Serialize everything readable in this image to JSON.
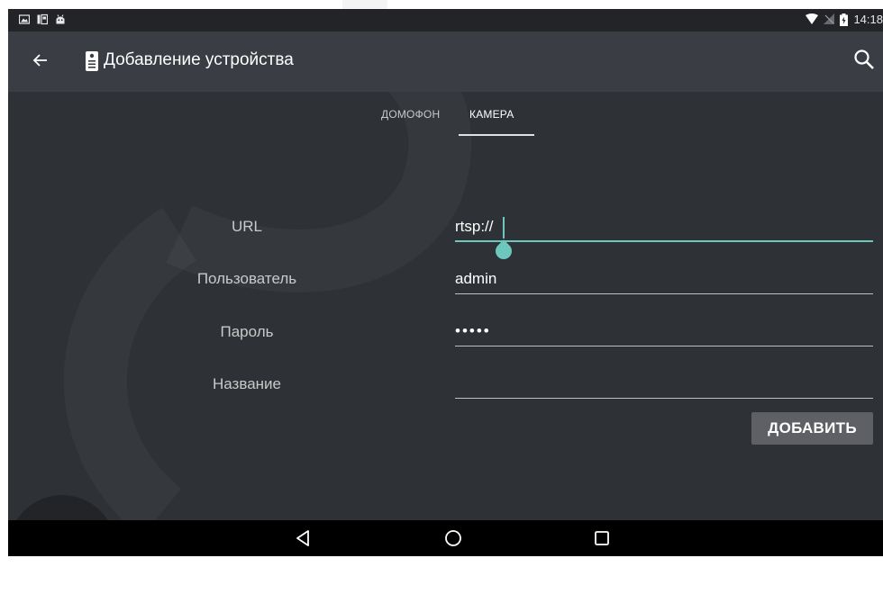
{
  "status_bar": {
    "time": "14:18",
    "icons_left": [
      "gallery-icon",
      "sim-toolkit-icon",
      "android-icon"
    ],
    "icons_right": [
      "wifi-icon",
      "no-signal-icon",
      "battery-charging-icon"
    ]
  },
  "app_bar": {
    "title": "Добавление устройства",
    "icons": [
      "back-arrow-icon",
      "intercom-device-icon",
      "search-icon"
    ]
  },
  "tabs": [
    {
      "label": "ДОМОФОН",
      "selected": false
    },
    {
      "label": "КАМЕРА",
      "selected": true
    }
  ],
  "form": {
    "url": {
      "label": "URL",
      "value": "rtsp://"
    },
    "user": {
      "label": "Пользователь",
      "value": "admin"
    },
    "password": {
      "label": "Пароль",
      "value": "•••••"
    },
    "name": {
      "label": "Название",
      "value": ""
    }
  },
  "add_button": {
    "label": "ДОБАВИТЬ"
  },
  "nav_bar": {
    "icons": [
      "back-triangle-icon",
      "home-circle-icon",
      "recents-square-icon"
    ]
  },
  "colors": {
    "background": "#2e3136",
    "app_bar": "#3a3d43",
    "accent": "#6ec7bd",
    "button": "#5e6066"
  }
}
